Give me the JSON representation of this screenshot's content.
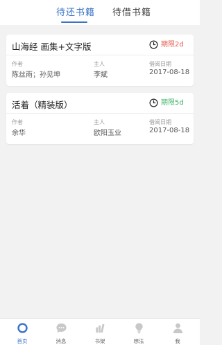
{
  "tabs": [
    {
      "label": "待还书籍",
      "active": true
    },
    {
      "label": "待借书籍",
      "active": false
    }
  ],
  "colors": {
    "accent": "#3a74c7",
    "due_urgent": "#e85b4f",
    "due_ok": "#3fb36a"
  },
  "books": [
    {
      "title": "山海经 画集+文字版",
      "due_label": "期限2d",
      "due_status": "urgent",
      "author_label": "作者",
      "author": "陈丝雨；孙见坤",
      "owner_label": "主人",
      "owner": "李斌",
      "date_label": "借阅日期",
      "date": "2017-08-18"
    },
    {
      "title": "活着（精装版）",
      "due_label": "期限5d",
      "due_status": "ok",
      "author_label": "作者",
      "author": "余华",
      "owner_label": "主人",
      "owner": "欧阳玉业",
      "date_label": "借阅日期",
      "date": "2017-08-18"
    }
  ],
  "bottom_nav": [
    {
      "label": "首页",
      "icon": "home-ring-icon",
      "active": true
    },
    {
      "label": "消息",
      "icon": "chat-bubble-icon",
      "active": false
    },
    {
      "label": "书架",
      "icon": "bookshelf-icon",
      "active": false
    },
    {
      "label": "想法",
      "icon": "lightbulb-icon",
      "active": false
    },
    {
      "label": "我",
      "icon": "user-icon",
      "active": false
    }
  ]
}
